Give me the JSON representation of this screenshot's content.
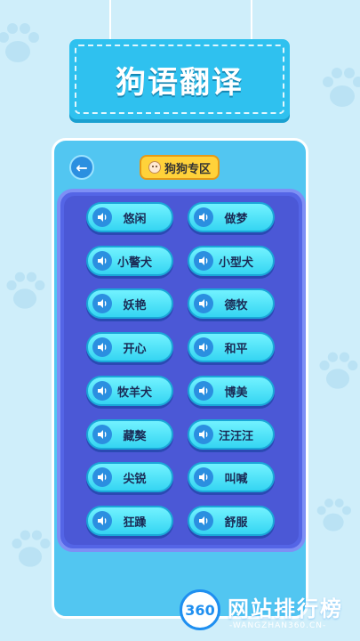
{
  "header": {
    "title": "狗语翻译"
  },
  "panel": {
    "back_icon": "arrow-left-icon",
    "zone_label": "狗狗专区"
  },
  "buttons": [
    {
      "label": "悠闲"
    },
    {
      "label": "做梦"
    },
    {
      "label": "小警犬"
    },
    {
      "label": "小型犬"
    },
    {
      "label": "妖艳"
    },
    {
      "label": "德牧"
    },
    {
      "label": "开心"
    },
    {
      "label": "和平"
    },
    {
      "label": "牧羊犬"
    },
    {
      "label": "博美"
    },
    {
      "label": "藏獒"
    },
    {
      "label": "汪汪汪"
    },
    {
      "label": "尖锐"
    },
    {
      "label": "叫喊"
    },
    {
      "label": "狂躁"
    },
    {
      "label": "舒服"
    }
  ],
  "watermark": {
    "logo_text": "360",
    "name": "网站排行榜",
    "url": "-WANGZHAN360.CN-"
  },
  "colors": {
    "background": "#cfeefa",
    "banner": "#2fc1ef",
    "panel": "#52c6f1",
    "grid": "#5465e6",
    "button": "#35d5f2",
    "badge": "#ffd23a"
  }
}
